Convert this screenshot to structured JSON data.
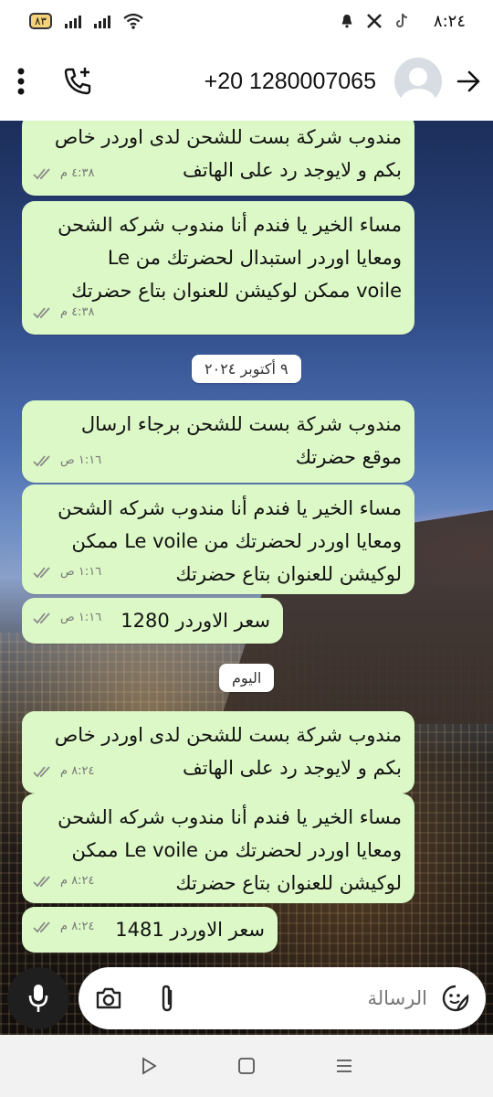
{
  "status_bar": {
    "time": "٨:٢٤",
    "battery": "٨٣"
  },
  "header": {
    "contact_number": "+20 1280007065"
  },
  "messages": [
    {
      "text": "مندوب شركة بست للشحن لدى اوردر خاص\nبكم و لايوجد رد على الهاتف",
      "time": "٤:٣٨ م"
    },
    {
      "text": "مساء الخير يا فندم أنا مندوب شركه الشحن\nومعايا اوردر استبدال لحضرتك من Le\nvoile ممكن لوكيشن للعنوان بتاع حضرتك",
      "time": "٤:٣٨ م"
    },
    {
      "text": "مندوب شركة بست للشحن برجاء ارسال\nموقع حضرتك",
      "time": "١:١٦ ص"
    },
    {
      "text": "مساء الخير يا فندم أنا مندوب شركه الشحن\nومعايا اوردر لحضرتك من Le voile ممكن\nلوكيشن للعنوان بتاع حضرتك",
      "time": "١:١٦ ص"
    },
    {
      "text": "سعر الاوردر 1280",
      "time": "١:١٦ ص"
    },
    {
      "text": "مندوب شركة بست للشحن لدى اوردر خاص\nبكم و لايوجد رد على الهاتف",
      "time": "٨:٢٤ م"
    },
    {
      "text": "مساء الخير يا فندم أنا مندوب شركه الشحن\nومعايا اوردر لحضرتك من Le voile ممكن\nلوكيشن للعنوان بتاع حضرتك",
      "time": "٨:٢٤ م"
    },
    {
      "text": "سعر الاوردر 1481",
      "time": "٨:٢٤ م"
    }
  ],
  "date_separators": [
    "٩ أكتوبر ٢٠٢٤",
    "اليوم"
  ],
  "input": {
    "placeholder": "الرسالة"
  },
  "colors": {
    "bubble": "#dcf8c6",
    "ticks": "#8a8a8a"
  }
}
